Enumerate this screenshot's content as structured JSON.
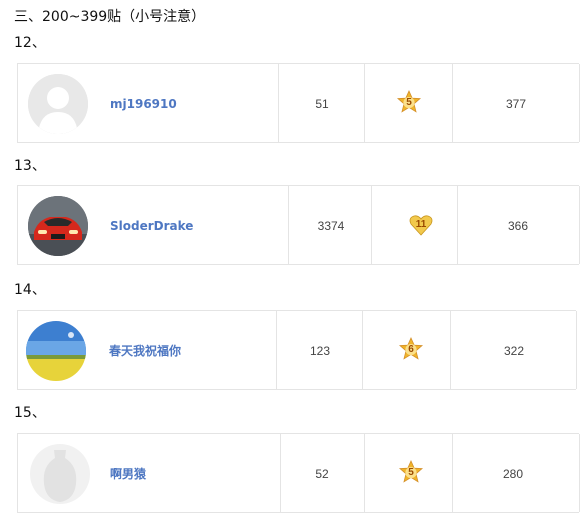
{
  "section": {
    "title": "三、200~399贴（小号注意）"
  },
  "entries": [
    {
      "rank": "12、",
      "username": "mj196910",
      "avatar": "default-avatar-icon",
      "posts": "51",
      "level": "5",
      "score": "377"
    },
    {
      "rank": "13、",
      "username": "SloderDrake",
      "avatar": "red-sports-car-icon",
      "posts": "3374",
      "level": "11",
      "score": "366"
    },
    {
      "rank": "14、",
      "username": "春天我祝福你",
      "avatar": "rapeseed-field-icon",
      "posts": "123",
      "level": "6",
      "score": "322"
    },
    {
      "rank": "15、",
      "username": "啊男猿",
      "avatar": "vase-silhouette-icon",
      "posts": "52",
      "level": "5",
      "score": "280"
    }
  ],
  "colors": {
    "username": "#4e77c2",
    "border": "#e4e4e4",
    "badge_star": "#f0b429",
    "badge_heart": "#f2c94c"
  }
}
